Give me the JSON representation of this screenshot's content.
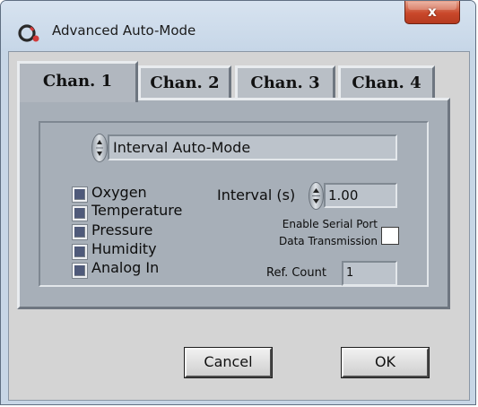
{
  "window": {
    "title": "Advanced Auto-Mode",
    "close_glyph": "x"
  },
  "tabs": [
    {
      "label": "Chan. 1",
      "active": true
    },
    {
      "label": "Chan. 2",
      "active": false
    },
    {
      "label": "Chan. 3",
      "active": false
    },
    {
      "label": "Chan. 4",
      "active": false
    }
  ],
  "mode_select": {
    "value": "Interval Auto-Mode"
  },
  "sensors": [
    {
      "label": "Oxygen"
    },
    {
      "label": "Temperature"
    },
    {
      "label": "Pressure"
    },
    {
      "label": "Humidity"
    },
    {
      "label": "Analog In"
    }
  ],
  "interval": {
    "label": "Interval (s)",
    "value": "1.00"
  },
  "serial": {
    "label_line1": "Enable Serial Port",
    "label_line2": "Data Transmission",
    "checked": false
  },
  "ref_count": {
    "label": "Ref. Count",
    "value": "1"
  },
  "buttons": {
    "cancel": "Cancel",
    "ok": "OK"
  },
  "colors": {
    "close_button": "#c9482b",
    "panel": "#a7afb8",
    "checkbox_fill": "#4f5a7a"
  }
}
